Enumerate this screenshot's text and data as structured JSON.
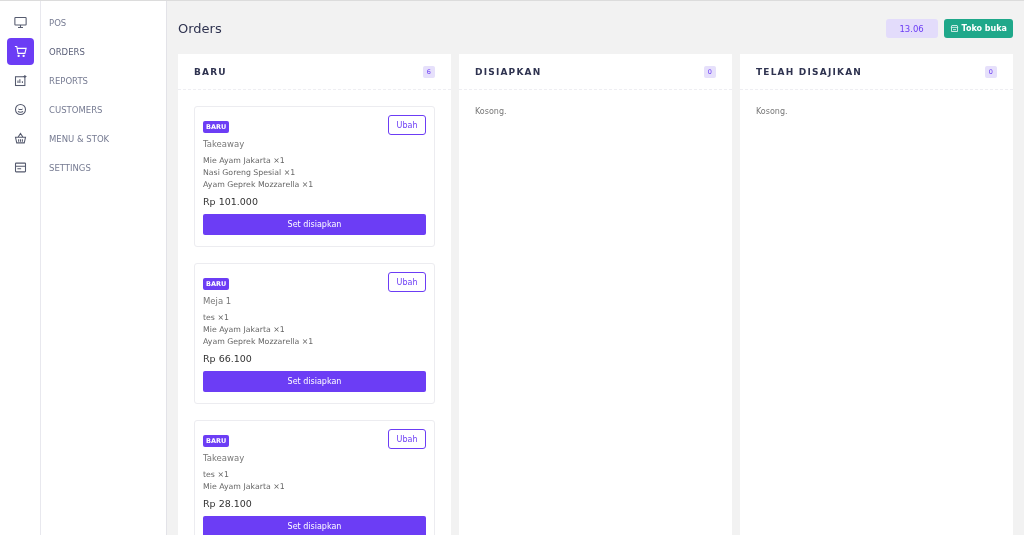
{
  "sidebar": {
    "items": [
      {
        "kind": "monitor",
        "label": "POS",
        "selected": false
      },
      {
        "kind": "cart",
        "label": "ORDERS",
        "selected": true
      },
      {
        "kind": "chart",
        "label": "REPORTS",
        "selected": false
      },
      {
        "kind": "face",
        "label": "CUSTOMERS",
        "selected": false
      },
      {
        "kind": "basket",
        "label": "MENU & STOK",
        "selected": false
      },
      {
        "kind": "card",
        "label": "SETTINGS",
        "selected": false
      }
    ]
  },
  "header": {
    "title": "Orders",
    "time": "13.06",
    "store_button": "Toko buka"
  },
  "columns": [
    {
      "title": "BARU",
      "count": "6",
      "orders": [
        {
          "status": "BARU",
          "edit_button": "Ubah",
          "location": "Takeaway",
          "items": [
            "Mie Ayam Jakarta ×1",
            "Nasi Goreng Spesial ×1",
            "Ayam Geprek Mozzarella ×1"
          ],
          "total": "Rp 101.000",
          "action": "Set disiapkan"
        },
        {
          "status": "BARU",
          "edit_button": "Ubah",
          "location": "Meja 1",
          "items": [
            "tes ×1",
            "Mie Ayam Jakarta ×1",
            "Ayam Geprek Mozzarella ×1"
          ],
          "total": "Rp 66.100",
          "action": "Set disiapkan"
        },
        {
          "status": "BARU",
          "edit_button": "Ubah",
          "location": "Takeaway",
          "items": [
            "tes ×1",
            "Mie Ayam Jakarta ×1"
          ],
          "total": "Rp 28.100",
          "action": "Set disiapkan"
        }
      ]
    },
    {
      "title": "DISIAPKAN",
      "count": "0",
      "empty_text": "Kosong."
    },
    {
      "title": "TELAH DISAJIKAN",
      "count": "0",
      "empty_text": "Kosong."
    }
  ]
}
